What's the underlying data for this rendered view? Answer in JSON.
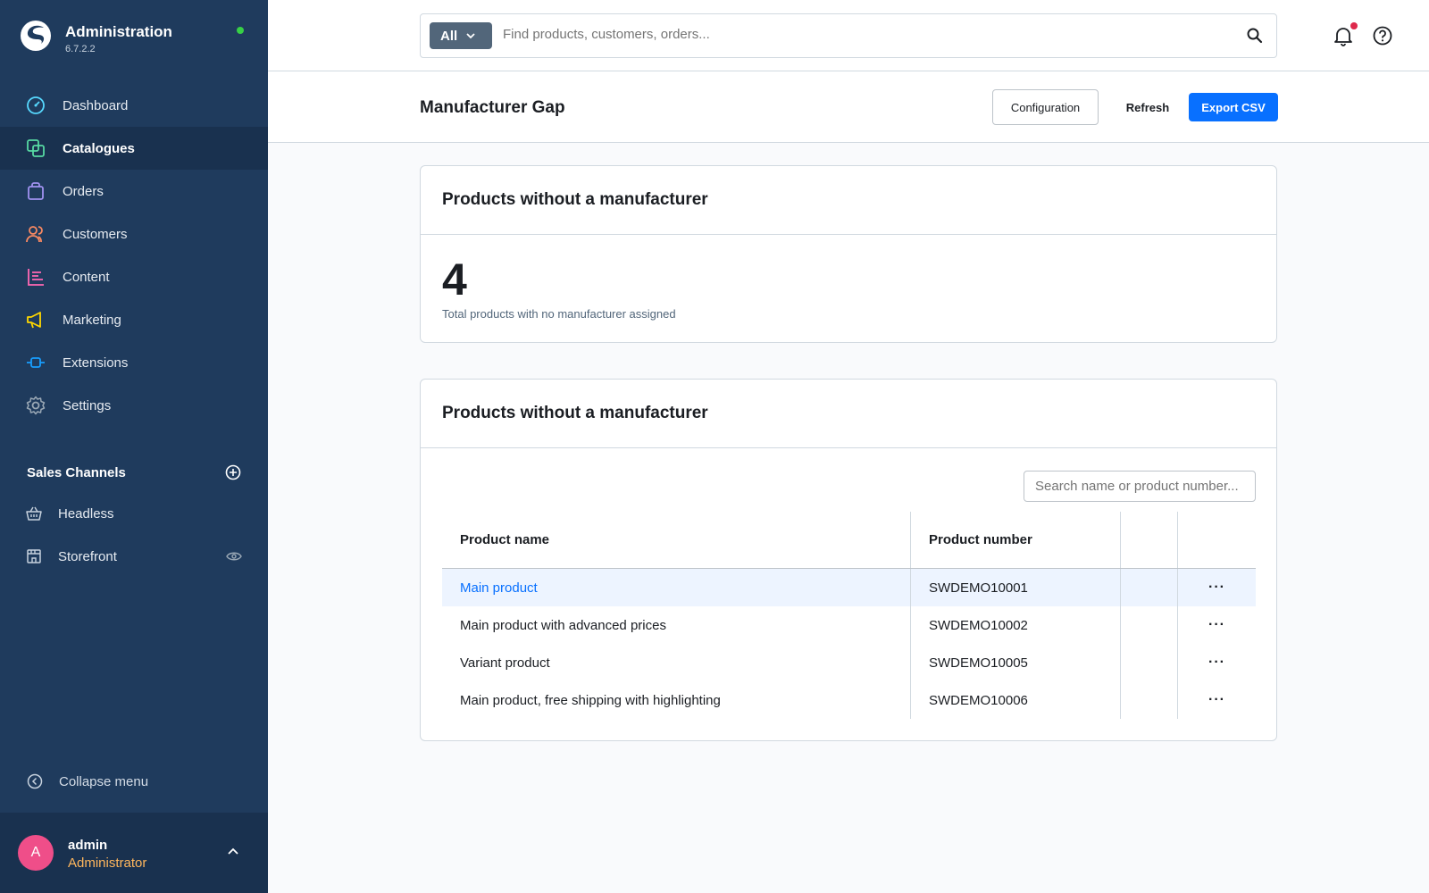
{
  "app": {
    "title": "Administration",
    "version": "6.7.2.2"
  },
  "sidebar": {
    "items": [
      {
        "label": "Dashboard",
        "icon": "dashboard-icon",
        "color": "#57d9ff"
      },
      {
        "label": "Catalogues",
        "icon": "catalogues-icon",
        "color": "#57d9a3"
      },
      {
        "label": "Orders",
        "icon": "orders-icon",
        "color": "#a092f0"
      },
      {
        "label": "Customers",
        "icon": "customers-icon",
        "color": "#f88962"
      },
      {
        "label": "Content",
        "icon": "content-icon",
        "color": "#ff68b4"
      },
      {
        "label": "Marketing",
        "icon": "marketing-icon",
        "color": "#ffd700"
      },
      {
        "label": "Extensions",
        "icon": "extensions-icon",
        "color": "#189eff"
      },
      {
        "label": "Settings",
        "icon": "settings-icon",
        "color": "#9aa8b5"
      }
    ],
    "active_index": 1,
    "sales_channels_title": "Sales Channels",
    "sales_channels": [
      {
        "label": "Headless",
        "icon": "basket-icon"
      },
      {
        "label": "Storefront",
        "icon": "storefront-icon"
      }
    ],
    "collapse_label": "Collapse menu"
  },
  "user": {
    "initial": "A",
    "name": "admin",
    "role": "Administrator"
  },
  "search": {
    "type_label": "All",
    "placeholder": "Find products, customers, orders..."
  },
  "smartbar": {
    "title": "Manufacturer Gap",
    "config_label": "Configuration",
    "refresh_label": "Refresh",
    "export_label": "Export CSV"
  },
  "summary_card": {
    "title": "Products without a manufacturer",
    "count": "4",
    "description": "Total products with no manufacturer assigned"
  },
  "list_card": {
    "title": "Products without a manufacturer",
    "search_placeholder": "Search name or product number...",
    "columns": [
      "Product name",
      "Product number"
    ],
    "rows": [
      {
        "name": "Main product",
        "number": "SWDEMO10001"
      },
      {
        "name": "Main product with advanced prices",
        "number": "SWDEMO10002"
      },
      {
        "name": "Variant product",
        "number": "SWDEMO10005"
      },
      {
        "name": "Main product, free shipping with highlighting",
        "number": "SWDEMO10006"
      }
    ],
    "actions_glyph": "···"
  },
  "colors": {
    "sidebar_bg": "#1f3b5d",
    "accent": "#0870ff",
    "status_online": "#37d046",
    "notification": "#de294c",
    "avatar": "#ef4e89",
    "role": "#ffb75d"
  }
}
